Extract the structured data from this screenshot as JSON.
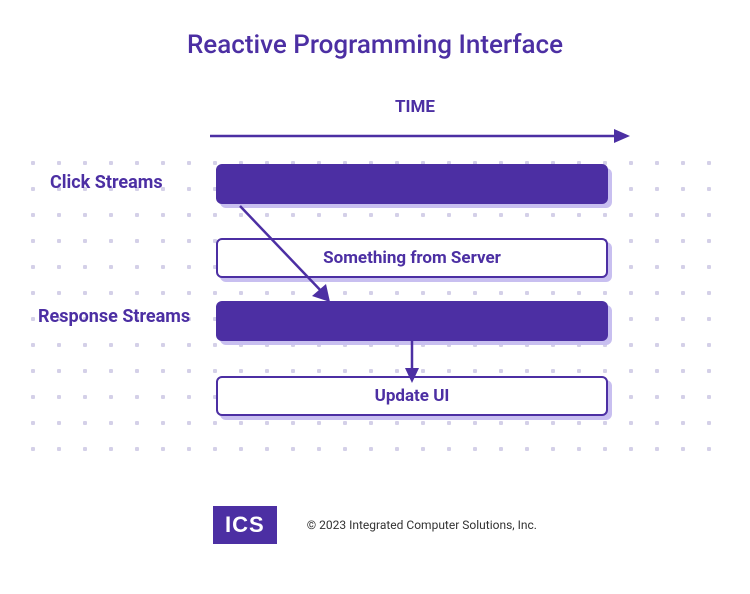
{
  "title": "Reactive Programming Interface",
  "time_label": "TIME",
  "labels": {
    "click_streams": "Click Streams",
    "response_streams": "Response Streams"
  },
  "boxes": {
    "something_from_server": "Something from Server",
    "update_ui": "Update UI"
  },
  "footer": {
    "logo": "ICS",
    "copyright": "© 2023 Integrated Computer Solutions, Inc."
  },
  "colors": {
    "primary": "#4c2fa3",
    "shadow": "#c8bff0",
    "dot": "#d4d0e8"
  }
}
